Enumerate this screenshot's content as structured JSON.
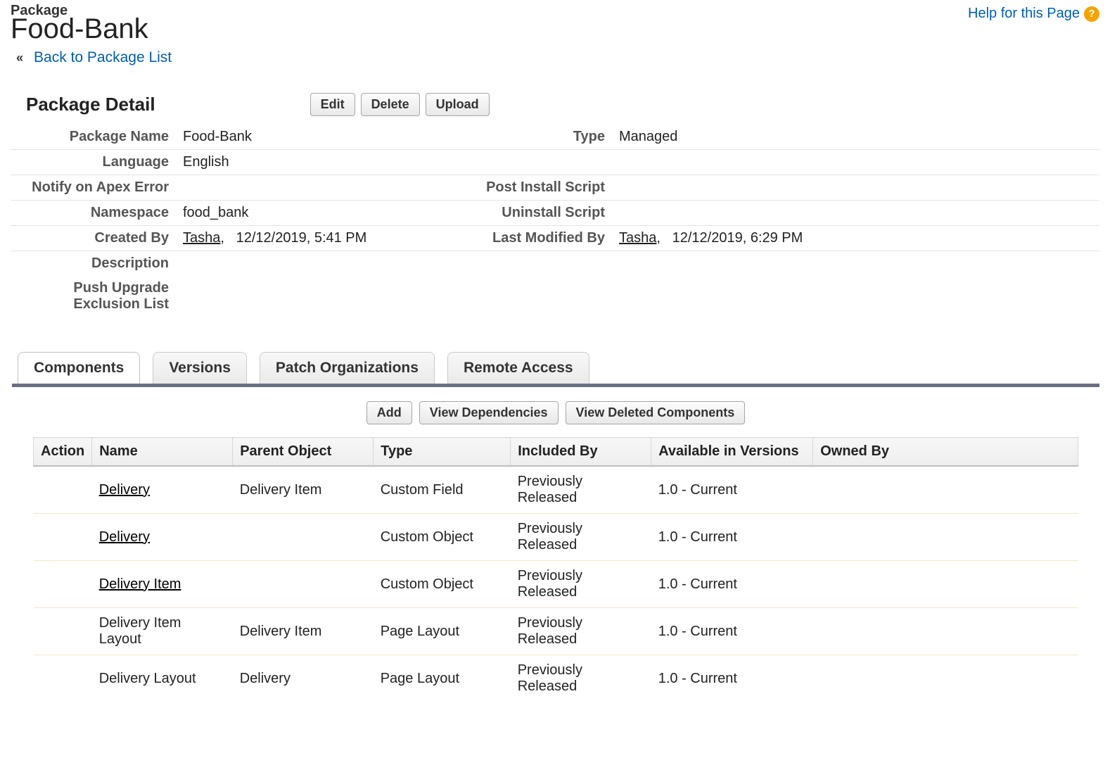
{
  "header": {
    "eyebrow": "Package",
    "title": "Food-Bank",
    "help_label": "Help for this Page",
    "back_chevron": "«",
    "back_label": "Back to Package List"
  },
  "section": {
    "title": "Package Detail",
    "buttons": {
      "edit": "Edit",
      "delete": "Delete",
      "upload": "Upload"
    }
  },
  "detail": {
    "labels": {
      "pkg_name": "Package Name",
      "type": "Type",
      "language": "Language",
      "notify": "Notify on Apex Error",
      "post_install": "Post Install Script",
      "namespace": "Namespace",
      "uninstall": "Uninstall Script",
      "created_by": "Created By",
      "modified_by": "Last Modified By",
      "description": "Description",
      "push_excl": "Push Upgrade Exclusion List"
    },
    "values": {
      "pkg_name": "Food-Bank",
      "type": "Managed",
      "language": "English",
      "notify": "",
      "post_install": "",
      "namespace": "food_bank",
      "uninstall": "",
      "created_by_user": "Tasha",
      "created_by_sep": ",",
      "created_by_time": "12/12/2019, 5:41 PM",
      "modified_by_user": "Tasha",
      "modified_by_sep": ",",
      "modified_by_time": "12/12/2019, 6:29 PM",
      "description": "",
      "push_excl": ""
    }
  },
  "tabs": {
    "components": "Components",
    "versions": "Versions",
    "patch": "Patch Organizations",
    "remote": "Remote Access"
  },
  "panel": {
    "buttons": {
      "add": "Add",
      "view_dep": "View Dependencies",
      "view_del": "View Deleted Components"
    }
  },
  "columns": {
    "action": "Action",
    "name": "Name",
    "parent": "Parent Object",
    "type": "Type",
    "included": "Included By",
    "avail": "Available in Versions",
    "owned": "Owned By"
  },
  "rows": [
    {
      "name": "Delivery",
      "link": true,
      "parent": "Delivery Item",
      "type": "Custom Field",
      "included": "Previously Released",
      "avail": "1.0 - Current",
      "owned": ""
    },
    {
      "name": "Delivery",
      "link": true,
      "parent": "",
      "type": "Custom Object",
      "included": "Previously Released",
      "avail": "1.0 - Current",
      "owned": ""
    },
    {
      "name": "Delivery Item",
      "link": true,
      "parent": "",
      "type": "Custom Object",
      "included": "Previously Released",
      "avail": "1.0 - Current",
      "owned": ""
    },
    {
      "name": "Delivery Item Layout",
      "link": false,
      "parent": "Delivery Item",
      "type": "Page Layout",
      "included": "Previously Released",
      "avail": "1.0 - Current",
      "owned": ""
    },
    {
      "name": "Delivery Layout",
      "link": false,
      "parent": "Delivery",
      "type": "Page Layout",
      "included": "Previously Released",
      "avail": "1.0 - Current",
      "owned": ""
    }
  ]
}
